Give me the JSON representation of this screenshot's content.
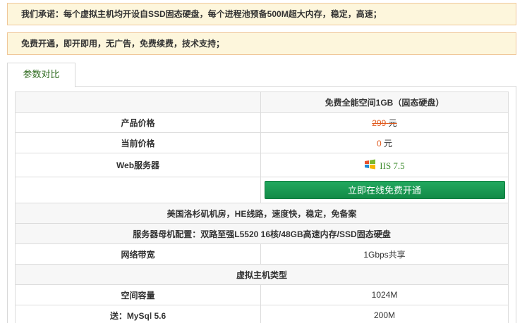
{
  "notices": {
    "line1": "我们承诺：每个虚拟主机均开设自SSD固态硬盘，每个进程池预备500M超大内存，稳定，高速；",
    "line2": "免费开通，即开即用，无广告，免费续费，技术支持；"
  },
  "tabs": {
    "active": "参数对比"
  },
  "table": {
    "header_product": "免费全能空间1GB（固态硬盘）",
    "rows": {
      "price_label": "产品价格",
      "price_value": "299",
      "price_unit": "元",
      "current_label": "当前价格",
      "current_value": "0",
      "current_unit": "元",
      "web_label": "Web服务器",
      "web_value": "IIS 7.5",
      "open_button": "立即在线免费开通",
      "datacenter": "美国洛杉矶机房，HE线路，速度快，稳定，免备案",
      "server_config": "服务器母机配置：双路至强L5520 16核/48GB高速内存/SSD固态硬盘",
      "bandwidth_label": "网络带宽",
      "bandwidth_value": "1Gbps共享",
      "host_type": "虚拟主机类型",
      "space_label": "空间容量",
      "space_value": "1024M",
      "mysql_label": "送：MySql 5.6",
      "mysql_value": "200M"
    }
  },
  "colors": {
    "notice_bg": "#fdf6dc",
    "notice_border": "#f0c89a",
    "tab_text": "#2e6a1e",
    "price_accent": "#e05a1e",
    "button_green": "#1a9a52",
    "iis_text": "#3a8a2a"
  },
  "icons": {
    "web_server": "windows-logo-icon"
  }
}
